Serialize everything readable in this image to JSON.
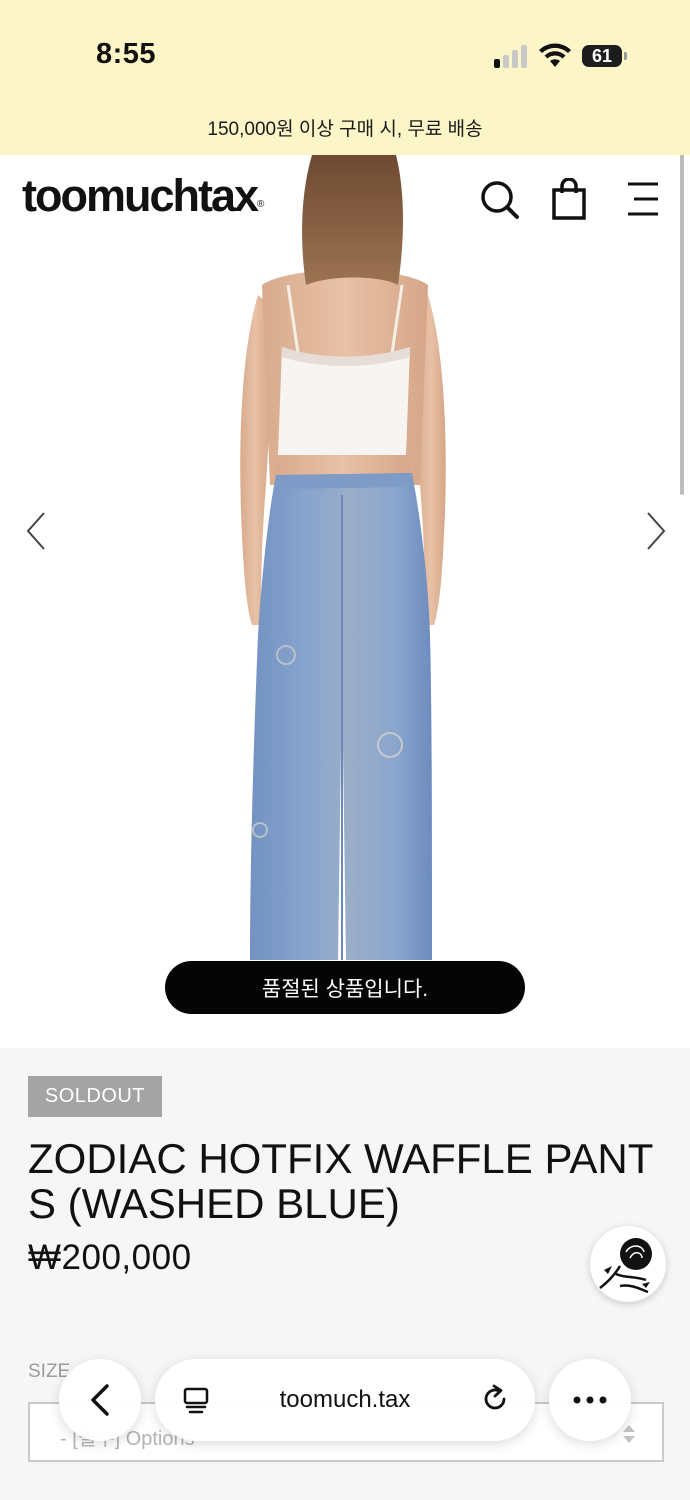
{
  "status_bar": {
    "time": "8:55",
    "battery": "61",
    "signal_bars_on": 1,
    "signal_bars_total": 4
  },
  "announcement": "150,000원 이상 구매 시, 무료 배송",
  "header": {
    "logo": "toomuchtax",
    "logo_mark": "®",
    "icons": [
      "search-icon",
      "shopping-bag-icon",
      "menu-icon"
    ]
  },
  "gallery": {
    "prev_icon": "chevron-left-icon",
    "next_icon": "chevron-right-icon",
    "soldout_message": "품절된 상품입니다."
  },
  "product": {
    "badge": "SOLDOUT",
    "name": "ZODIAC HOTFIX WAFFLE PANTS (WASHED BLUE)",
    "price": "₩200,000",
    "option_label": "SIZE",
    "option_placeholder": "- [필수] Options"
  },
  "browser": {
    "url": "toomuch.tax",
    "back_icon": "back-icon",
    "tabs_icon": "tabs-icon",
    "reload_icon": "reload-icon",
    "more_icon": "more-icon"
  },
  "colors": {
    "announcement_bg": "#fbf5c8",
    "pants": "#7f9fcd",
    "top": "#f7f4f2",
    "badge_bg": "#a4a4a4"
  }
}
